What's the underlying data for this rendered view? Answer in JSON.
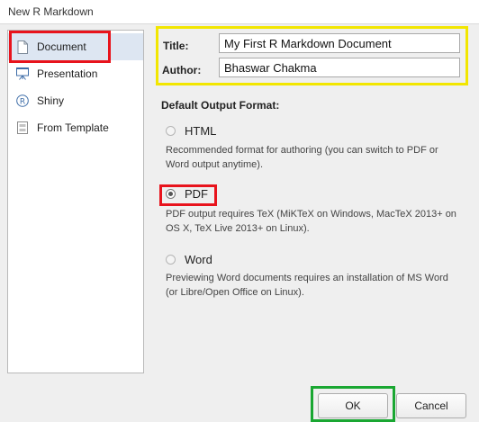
{
  "window": {
    "title": "New R Markdown"
  },
  "sidebar": {
    "items": [
      {
        "label": "Document",
        "icon": "document-icon",
        "selected": true
      },
      {
        "label": "Presentation",
        "icon": "presentation-icon",
        "selected": false
      },
      {
        "label": "Shiny",
        "icon": "shiny-r-icon",
        "selected": false
      },
      {
        "label": "From Template",
        "icon": "template-icon",
        "selected": false
      }
    ]
  },
  "form": {
    "title_label": "Title:",
    "title_value": "My First R Markdown Document",
    "author_label": "Author:",
    "author_value": "Bhaswar Chakma"
  },
  "output": {
    "section_label": "Default Output Format:",
    "options": [
      {
        "label": "HTML",
        "checked": false,
        "description": "Recommended format for authoring (you can switch to PDF or Word output anytime)."
      },
      {
        "label": "PDF",
        "checked": true,
        "description": "PDF output requires TeX (MiKTeX on Windows, MacTeX 2013+ on OS X, TeX Live 2013+ on Linux)."
      },
      {
        "label": "Word",
        "checked": false,
        "description": "Previewing Word documents requires an installation of MS Word (or Libre/Open Office on Linux)."
      }
    ]
  },
  "buttons": {
    "ok": "OK",
    "cancel": "Cancel"
  },
  "annotations": {
    "red": "#e8131c",
    "yellow": "#f2e600",
    "green": "#1aa732"
  }
}
